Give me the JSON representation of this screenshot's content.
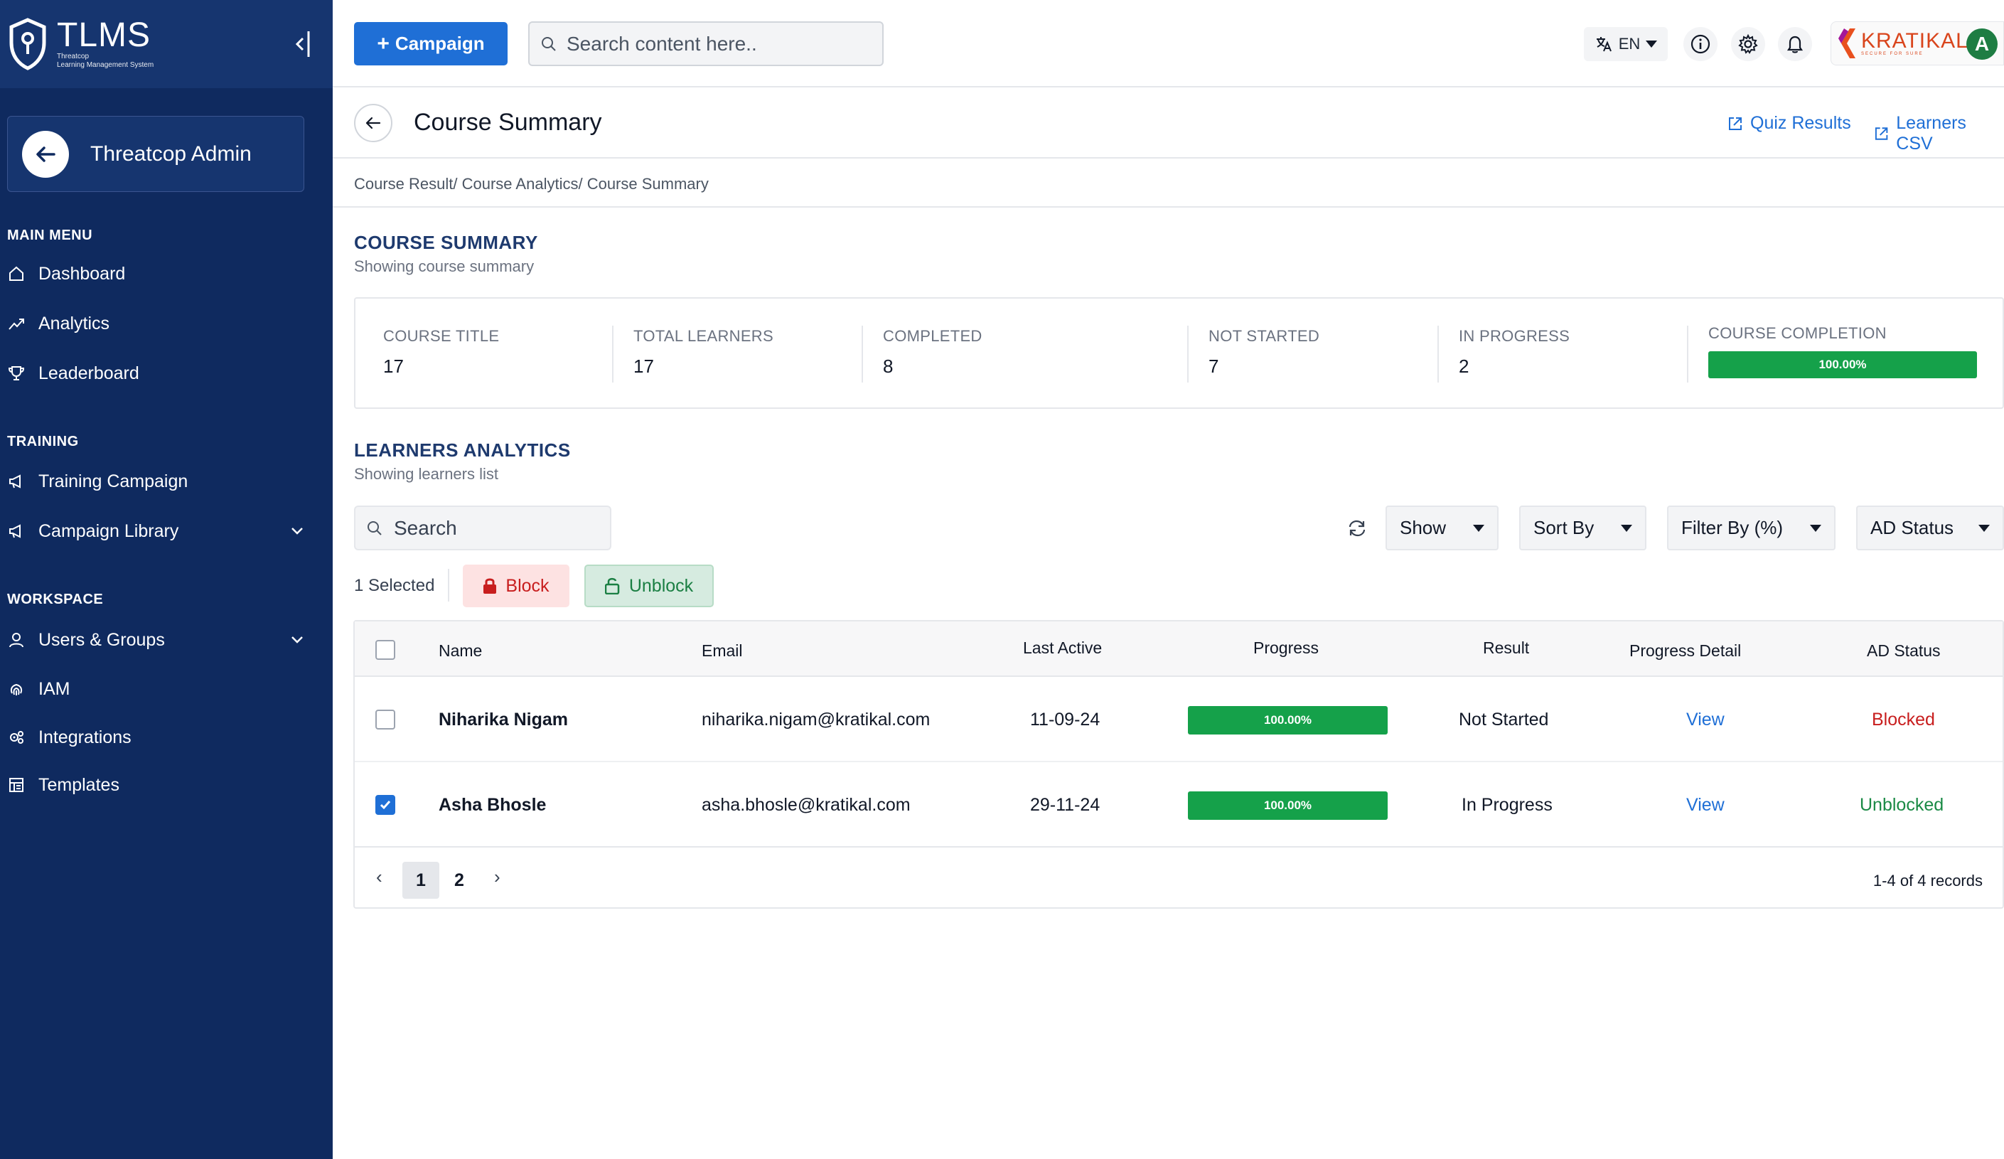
{
  "brand": {
    "name": "TLMS",
    "sub1": "Threatcop",
    "sub2": "Learning Management System"
  },
  "admin": {
    "label": "Threatcop Admin"
  },
  "sidebar": {
    "sections": [
      {
        "title": "MAIN MENU"
      },
      {
        "title": "TRAINING"
      },
      {
        "title": "WORKSPACE"
      }
    ],
    "items": [
      {
        "label": "Dashboard",
        "icon": "home-icon"
      },
      {
        "label": "Analytics",
        "icon": "chart-line-icon"
      },
      {
        "label": "Leaderboard",
        "icon": "trophy-icon"
      },
      {
        "label": "Training Campaign",
        "icon": "megaphone-icon"
      },
      {
        "label": "Campaign Library",
        "icon": "megaphone-icon"
      },
      {
        "label": "Users & Groups",
        "icon": "user-icon"
      },
      {
        "label": "IAM",
        "icon": "fingerprint-icon"
      },
      {
        "label": "Integrations",
        "icon": "gears-icon"
      },
      {
        "label": "Templates",
        "icon": "template-icon"
      }
    ]
  },
  "topbar": {
    "campaign_label": "Campaign",
    "search_placeholder": "Search content here..",
    "language": "EN",
    "org_name": "KRATIKAL",
    "org_tagline": "SECURE FOR SURE",
    "avatar_initial": "A"
  },
  "page": {
    "title": "Course Summary",
    "quiz_results": "Quiz Results",
    "learners_csv": "Learners CSV",
    "breadcrumb": "Course Result/ Course Analytics/ Course Summary"
  },
  "summary": {
    "title": "COURSE SUMMARY",
    "subtitle": "Showing course summary",
    "stats": [
      {
        "label": "COURSE TITLE",
        "value": "17"
      },
      {
        "label": "TOTAL LEARNERS",
        "value": "17"
      },
      {
        "label": "COMPLETED",
        "value": "8"
      },
      {
        "label": "NOT STARTED",
        "value": "7"
      },
      {
        "label": "IN PROGRESS",
        "value": "2"
      }
    ],
    "completion_label": "COURSE COMPLETION",
    "completion_value": "100.00%",
    "completion_fraction": 1.0
  },
  "learners": {
    "title": "LEARNERS ANALYTICS",
    "subtitle": "Showing learners list",
    "search_placeholder": "Search",
    "filters": {
      "show": "Show",
      "sort_by": "Sort By",
      "filter_by": "Filter By (%)",
      "ad_status": "AD Status"
    },
    "selected_text": "1 Selected",
    "block_label": "Block",
    "unblock_label": "Unblock",
    "columns": {
      "name": "Name",
      "email": "Email",
      "last_active": "Last Active",
      "progress": "Progress",
      "result": "Result",
      "progress_detail": "Progress Detail",
      "ad_status": "AD Status"
    },
    "rows": [
      {
        "name": "Niharika Nigam",
        "email": "niharika.nigam@kratikal.com",
        "last_active": "11-09-24",
        "progress": "100.00%",
        "progress_fraction": 1.0,
        "result": "Not Started",
        "detail": "View",
        "ad_status": "Blocked",
        "checked": false
      },
      {
        "name": "Asha Bhosle",
        "email": "asha.bhosle@kratikal.com",
        "last_active": "29-11-24",
        "progress": "100.00%",
        "progress_fraction": 1.0,
        "result": "In Progress",
        "detail": "View",
        "ad_status": "Unblocked",
        "checked": true
      }
    ],
    "pagination": {
      "prev": "‹",
      "next": "›",
      "pages": [
        "1",
        "2"
      ],
      "current": "1",
      "records": "1-4 of 4 records"
    }
  },
  "colors": {
    "sidebar_bg": "#0f2a5f",
    "accent": "#1f6fd6",
    "progress": "#15a14a",
    "blocked": "#c81e1e",
    "unblocked": "#1a8a45"
  }
}
